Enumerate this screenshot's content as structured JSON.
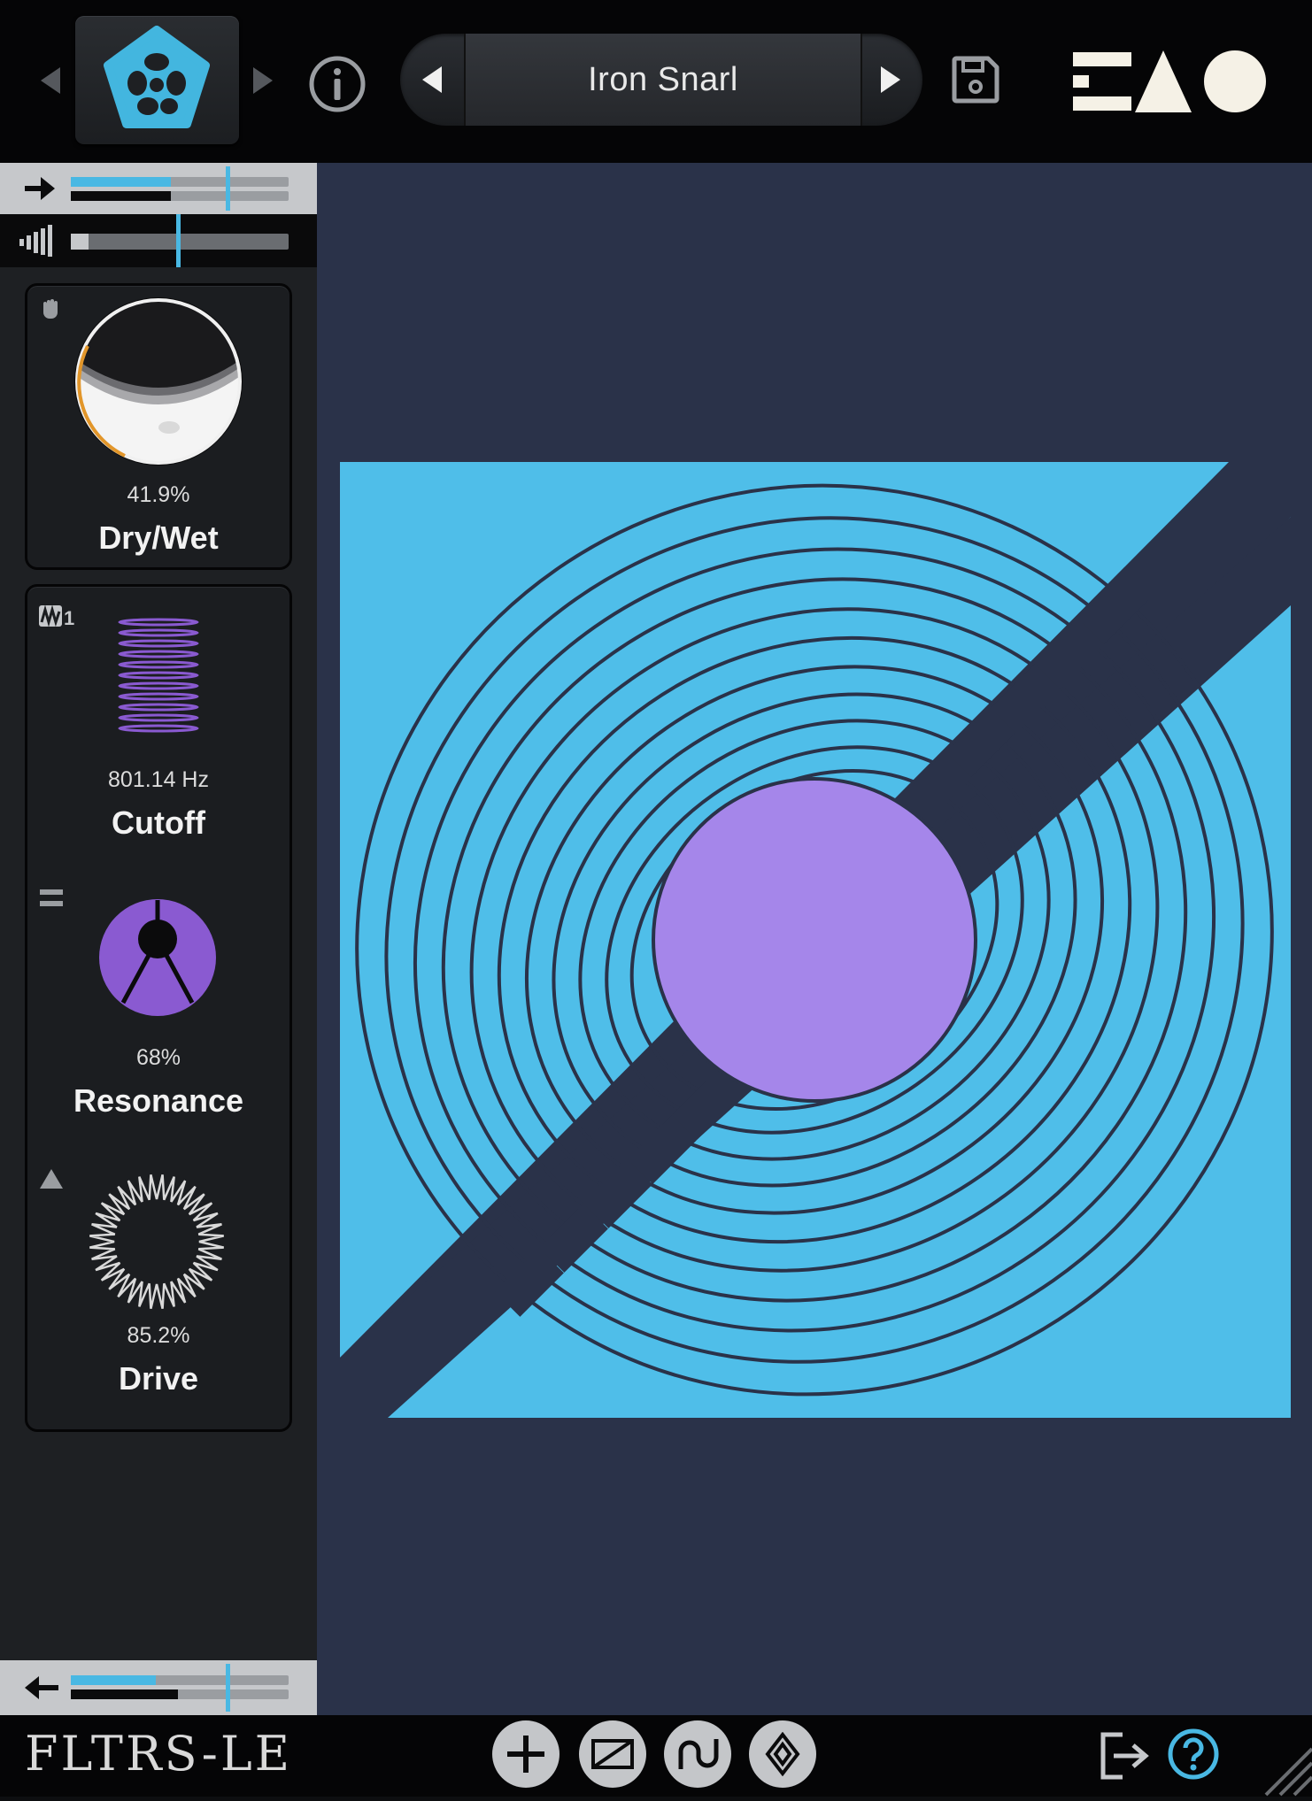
{
  "header": {
    "preset_name": "Iron Snarl"
  },
  "controls": {
    "dry_wet": {
      "value_text": "41.9%",
      "label": "Dry/Wet"
    },
    "cutoff": {
      "value_text": "801.14 Hz",
      "label": "Cutoff",
      "mod_badge": "1"
    },
    "resonance": {
      "value_text": "68%",
      "label": "Resonance"
    },
    "drive": {
      "value_text": "85.2%",
      "label": "Drive"
    }
  },
  "meters": {
    "input_level": 0.45,
    "volume_level": 0.06,
    "output_level": 0.5
  },
  "footer": {
    "product_name": "FLTRS-LE"
  },
  "colors": {
    "accent_blue": "#49b8e3",
    "art_blue": "#4fbee9",
    "art_purple": "#a586ea",
    "canvas_bg": "#2a3249",
    "purple_control": "#8a5ad1"
  },
  "icons": [
    "preset-prev-small-icon",
    "logo-star-icon",
    "preset-next-small-icon",
    "info-icon",
    "preset-prev-icon",
    "preset-next-icon",
    "save-icon",
    "brand-mark-icon",
    "input-arrow-icon",
    "volume-icon",
    "hand-icon",
    "waveform-mod-icon",
    "equals-icon",
    "triangle-icon",
    "collapse-left-icon",
    "output-arrow-icon",
    "add-icon",
    "slope-icon",
    "wave-icon",
    "diamonds-icon",
    "exit-icon",
    "help-icon"
  ]
}
